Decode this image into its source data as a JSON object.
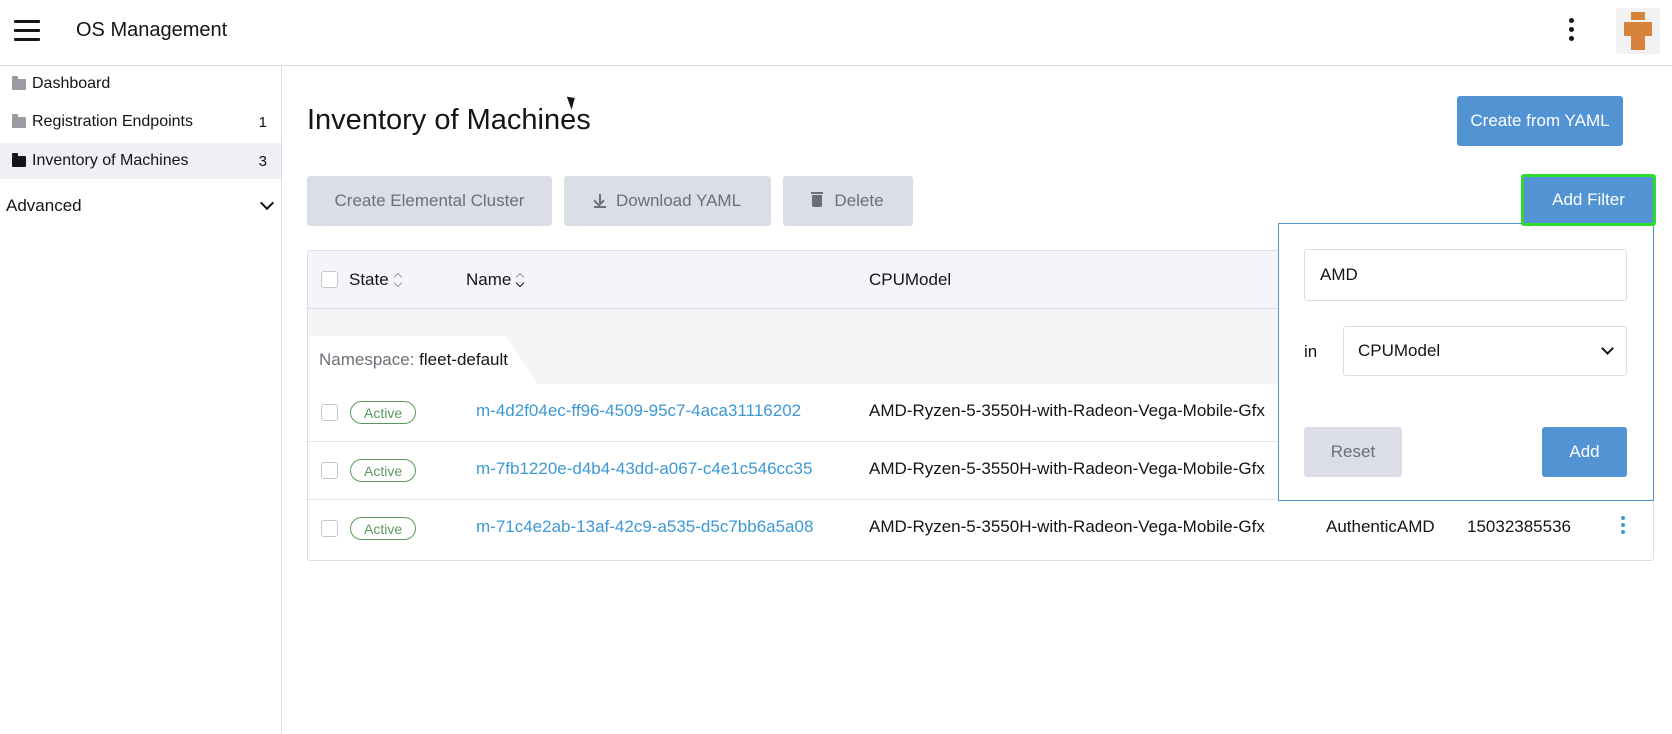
{
  "header": {
    "app_title": "OS Management",
    "menu_icon": "hamburger-icon",
    "more_icon": "kebab-icon"
  },
  "sidebar": {
    "items": [
      {
        "label": "Dashboard",
        "count": ""
      },
      {
        "label": "Registration Endpoints",
        "count": "1"
      },
      {
        "label": "Inventory of Machines",
        "count": "3"
      }
    ],
    "group": {
      "label": "Advanced"
    }
  },
  "main": {
    "title": "Inventory of Machines",
    "create_yaml_label": "Create from YAML",
    "create_cluster_label": "Create Elemental Cluster",
    "download_yaml_label": "Download YAML",
    "delete_label": "Delete",
    "add_filter_label": "Add Filter"
  },
  "table": {
    "headers": {
      "state": "State",
      "name": "Name",
      "cpu": "CPUModel"
    },
    "group": {
      "prefix": "Namespace:",
      "value": "fleet-default"
    },
    "rows": [
      {
        "state": "Active",
        "name": "m-4d2f04ec-ff96-4509-95c7-4aca31116202",
        "cpu": "AMD-Ryzen-5-3550H-with-Radeon-Vega-Mobile-Gfx",
        "vendor": "",
        "memory": ""
      },
      {
        "state": "Active",
        "name": "m-7fb1220e-d4b4-43dd-a067-c4e1c546cc35",
        "cpu": "AMD-Ryzen-5-3550H-with-Radeon-Vega-Mobile-Gfx",
        "vendor": "",
        "memory": ""
      },
      {
        "state": "Active",
        "name": "m-71c4e2ab-13af-42c9-a535-d5c7bb6a5a08",
        "cpu": "AMD-Ryzen-5-3550H-with-Radeon-Vega-Mobile-Gfx",
        "vendor": "AuthenticAMD",
        "memory": "15032385536"
      }
    ]
  },
  "filter": {
    "value": "AMD",
    "in_label": "in",
    "field": "CPUModel",
    "reset_label": "Reset",
    "add_label": "Add"
  },
  "colors": {
    "primary": "#5193d3",
    "link": "#3d98d3",
    "active_badge": "#5d995d",
    "highlight": "#2ddc2d"
  }
}
